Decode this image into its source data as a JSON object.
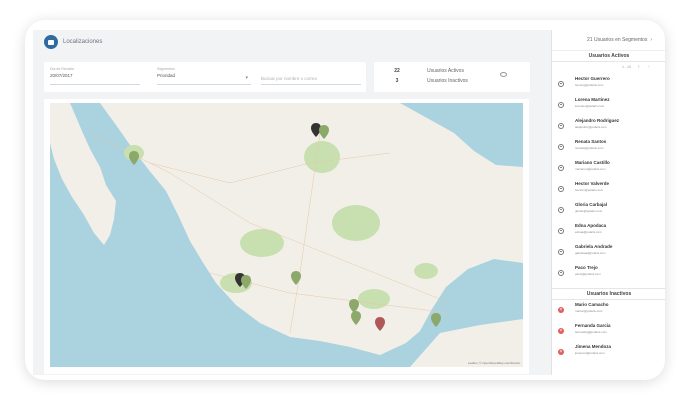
{
  "header": {
    "title": "Localizaciones"
  },
  "filters": {
    "date_label": "Día de Reunión",
    "date_value": "20/07/2017",
    "segment_label": "Segmentos",
    "segment_value": "Prioridad",
    "search_placeholder": "Buscar por nombre o correo"
  },
  "stats": {
    "active_count": "22",
    "active_label": "Usuarios Activos",
    "inactive_count": "3",
    "inactive_label": "Usuarios Inactivos"
  },
  "sidebar": {
    "top_link": "21 Usuarios en Segmentos",
    "active_title": "Usuarios Activos",
    "pager": "1 - 10",
    "active_users": [
      {
        "name": "Hector Guerrero",
        "email": "hectorg@polaris.com"
      },
      {
        "name": "Lorena Martinez",
        "email": "lorenam@polaris.com"
      },
      {
        "name": "Alejandro Rodriguez",
        "email": "alejandror@polaris.com"
      },
      {
        "name": "Renata Santos",
        "email": "renatas@polaris.com"
      },
      {
        "name": "Mariano Castillo",
        "email": "marianoc@polaris.com"
      },
      {
        "name": "Hector Valverde",
        "email": "hectorv@polaris.com"
      },
      {
        "name": "Gloria Carbajal",
        "email": "gloriac@polaris.com"
      },
      {
        "name": "Edna Apodaca",
        "email": "ednaa@polaris.com"
      },
      {
        "name": "Gabriela Andrade",
        "email": "gabrielaa@polaris.com"
      },
      {
        "name": "Paco Trejo",
        "email": "pacot@polaris.com"
      }
    ],
    "inactive_title": "Usuarios Inactivos",
    "inactive_users": [
      {
        "name": "Mario Camacho",
        "email": "marioc@polaris.com"
      },
      {
        "name": "Fernanda Garcia",
        "email": "fernandag@polaris.com"
      },
      {
        "name": "Jimena Mendoza",
        "email": "jimenam@polaris.com"
      }
    ]
  },
  "map": {
    "attribution": "Leaflet | © OpenStreetMap contributors",
    "colors": {
      "sea": "#aad3df",
      "land": "#f2efe9",
      "park": "#c8dfb0",
      "marker_green": "#8da86b",
      "marker_dark": "#333333",
      "marker_red": "#b05858"
    }
  }
}
